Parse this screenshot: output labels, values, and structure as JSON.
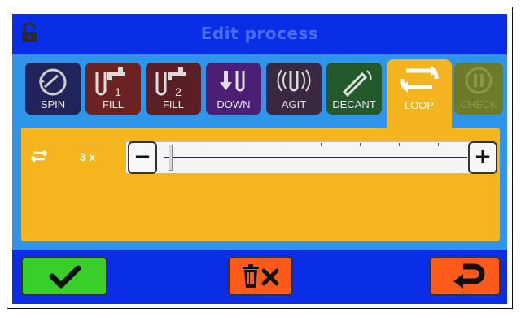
{
  "header": {
    "title": "Edit process",
    "lock_icon": "lock-icon"
  },
  "tabs": [
    {
      "label": "SPIN",
      "icon": "spin-icon"
    },
    {
      "label": "FILL",
      "number": "1",
      "icon": "faucet-tube-icon"
    },
    {
      "label": "FILL",
      "number": "2",
      "icon": "faucet-tube-icon"
    },
    {
      "label": "DOWN",
      "icon": "down-arrows-icon"
    },
    {
      "label": "AGIT",
      "icon": "agitate-icon"
    },
    {
      "label": "DECANT",
      "icon": "decant-icon"
    },
    {
      "label": "LOOP",
      "icon": "loop-icon",
      "selected": true
    },
    {
      "label": "CHECK",
      "icon": "pause-icon"
    }
  ],
  "panel": {
    "loop_icon": "loop-icon",
    "count_text": "3 x",
    "slider": {
      "minus_label": "−",
      "plus_label": "+",
      "level": 0.0
    }
  },
  "footer": {
    "confirm_icon": "checkmark-icon",
    "delete_icon": "trash-x-icon",
    "return_icon": "return-arrow-icon"
  },
  "colors": {
    "header_bg": "#0a2ee6",
    "screen_bg": "#2f95ea",
    "panel_bg": "#f5b51e",
    "confirm_bg": "#38d028",
    "action_bg": "#ff5a1a"
  }
}
